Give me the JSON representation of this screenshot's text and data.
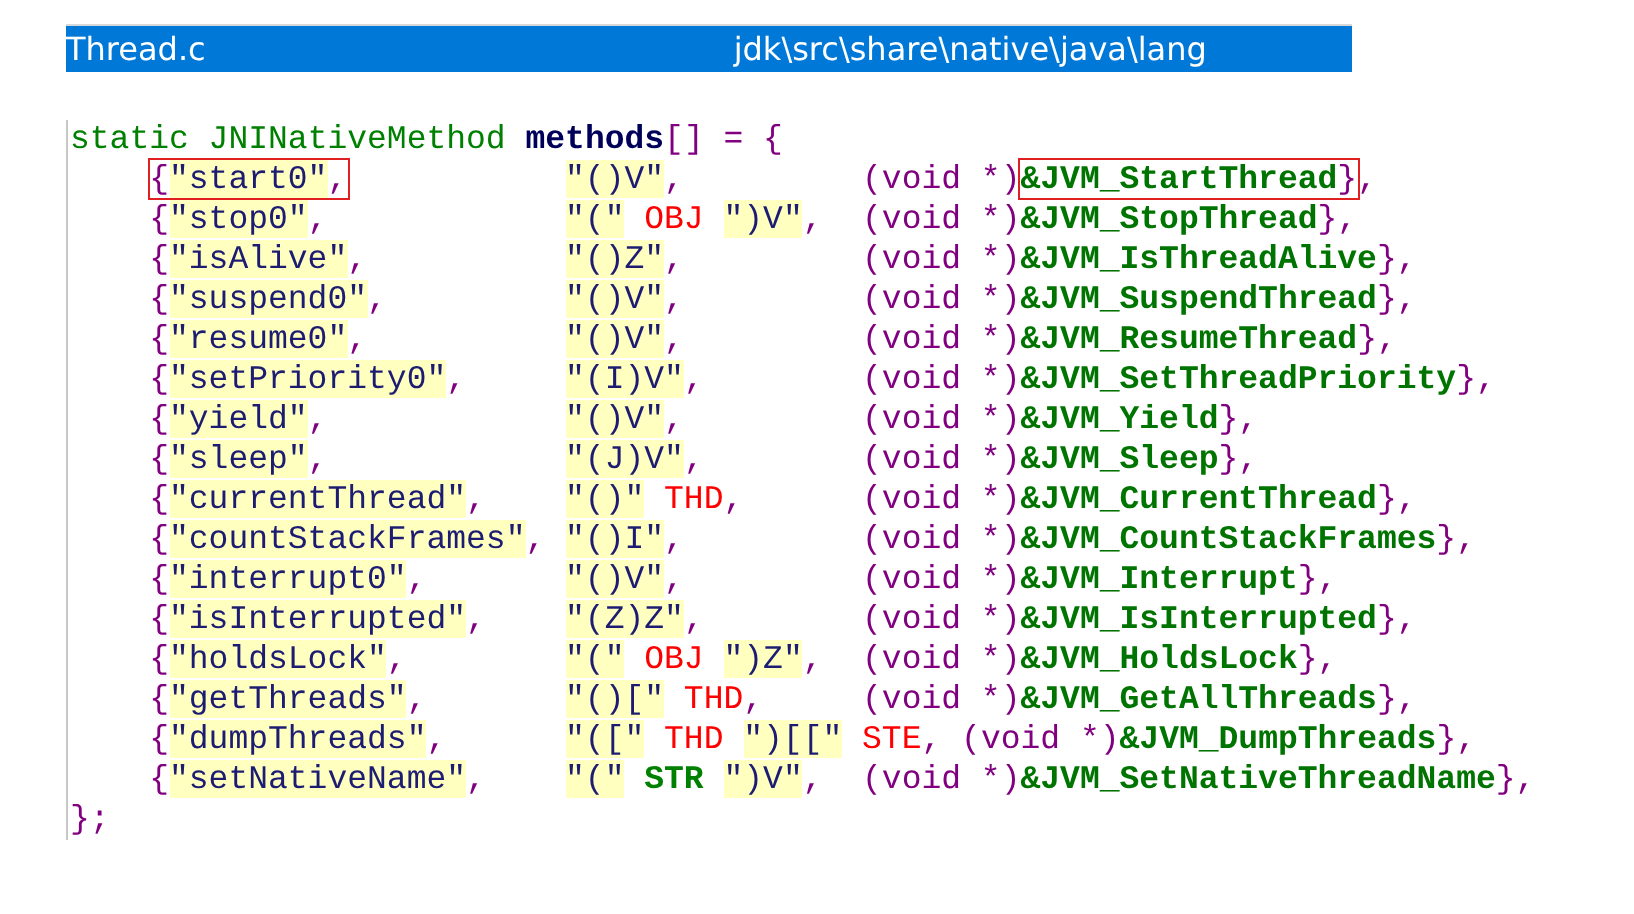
{
  "file_bar": {
    "file_name": "Thread.c",
    "path": "jdk\\src\\share\\native\\java\\lang"
  },
  "code": {
    "declaration": [
      {
        "kind": "keyword",
        "text": "static JNINativeMethod"
      },
      {
        "kind": "identifier",
        "text": "methods"
      },
      {
        "kind": "punct",
        "text": "[] = {"
      }
    ],
    "rows": [
      {
        "open": "{",
        "name": "\"start0\"",
        "sep": ",",
        "signature": [
          {
            "kind": "string",
            "text": "\"()V\""
          }
        ],
        "tail": ",",
        "cast": "(void *)",
        "target": "&JVM_StartThread",
        "close": "}",
        "end": ",",
        "boxed": true
      },
      {
        "open": "{",
        "name": "\"stop0\"",
        "sep": ",",
        "signature": [
          {
            "kind": "string",
            "text": "\"(\""
          },
          {
            "kind": "macro",
            "text": "OBJ"
          },
          {
            "kind": "string",
            "text": "\")V\""
          }
        ],
        "tail": ",",
        "cast": "(void *)",
        "target": "&JVM_StopThread",
        "close": "}",
        "end": ",",
        "boxed": false
      },
      {
        "open": "{",
        "name": "\"isAlive\"",
        "sep": ",",
        "signature": [
          {
            "kind": "string",
            "text": "\"()Z\""
          }
        ],
        "tail": ",",
        "cast": "(void *)",
        "target": "&JVM_IsThreadAlive",
        "close": "}",
        "end": ",",
        "boxed": false
      },
      {
        "open": "{",
        "name": "\"suspend0\"",
        "sep": ",",
        "signature": [
          {
            "kind": "string",
            "text": "\"()V\""
          }
        ],
        "tail": ",",
        "cast": "(void *)",
        "target": "&JVM_SuspendThread",
        "close": "}",
        "end": ",",
        "boxed": false
      },
      {
        "open": "{",
        "name": "\"resume0\"",
        "sep": ",",
        "signature": [
          {
            "kind": "string",
            "text": "\"()V\""
          }
        ],
        "tail": ",",
        "cast": "(void *)",
        "target": "&JVM_ResumeThread",
        "close": "}",
        "end": ",",
        "boxed": false
      },
      {
        "open": "{",
        "name": "\"setPriority0\"",
        "sep": ",",
        "signature": [
          {
            "kind": "string",
            "text": "\"(I)V\""
          }
        ],
        "tail": ",",
        "cast": "(void *)",
        "target": "&JVM_SetThreadPriority",
        "close": "}",
        "end": ",",
        "boxed": false
      },
      {
        "open": "{",
        "name": "\"yield\"",
        "sep": ",",
        "signature": [
          {
            "kind": "string",
            "text": "\"()V\""
          }
        ],
        "tail": ",",
        "cast": "(void *)",
        "target": "&JVM_Yield",
        "close": "}",
        "end": ",",
        "boxed": false
      },
      {
        "open": "{",
        "name": "\"sleep\"",
        "sep": ",",
        "signature": [
          {
            "kind": "string",
            "text": "\"(J)V\""
          }
        ],
        "tail": ",",
        "cast": "(void *)",
        "target": "&JVM_Sleep",
        "close": "}",
        "end": ",",
        "boxed": false
      },
      {
        "open": "{",
        "name": "\"currentThread\"",
        "sep": ",",
        "signature": [
          {
            "kind": "string",
            "text": "\"()\""
          },
          {
            "kind": "macro",
            "text": "THD"
          }
        ],
        "tail": ",",
        "cast": "(void *)",
        "target": "&JVM_CurrentThread",
        "close": "}",
        "end": ",",
        "boxed": false
      },
      {
        "open": "{",
        "name": "\"countStackFrames\"",
        "sep": ",",
        "signature": [
          {
            "kind": "string",
            "text": "\"()I\""
          }
        ],
        "tail": ",",
        "cast": "(void *)",
        "target": "&JVM_CountStackFrames",
        "close": "}",
        "end": ",",
        "boxed": false
      },
      {
        "open": "{",
        "name": "\"interrupt0\"",
        "sep": ",",
        "signature": [
          {
            "kind": "string",
            "text": "\"()V\""
          }
        ],
        "tail": ",",
        "cast": "(void *)",
        "target": "&JVM_Interrupt",
        "close": "}",
        "end": ",",
        "boxed": false
      },
      {
        "open": "{",
        "name": "\"isInterrupted\"",
        "sep": ",",
        "signature": [
          {
            "kind": "string",
            "text": "\"(Z)Z\""
          }
        ],
        "tail": ",",
        "cast": "(void *)",
        "target": "&JVM_IsInterrupted",
        "close": "}",
        "end": ",",
        "boxed": false
      },
      {
        "open": "{",
        "name": "\"holdsLock\"",
        "sep": ",",
        "signature": [
          {
            "kind": "string",
            "text": "\"(\""
          },
          {
            "kind": "macro",
            "text": "OBJ"
          },
          {
            "kind": "string",
            "text": "\")Z\""
          }
        ],
        "tail": ",",
        "cast": "(void *)",
        "target": "&JVM_HoldsLock",
        "close": "}",
        "end": ",",
        "boxed": false
      },
      {
        "open": "{",
        "name": "\"getThreads\"",
        "sep": ",",
        "signature": [
          {
            "kind": "string",
            "text": "\"()[\""
          },
          {
            "kind": "macro",
            "text": "THD"
          }
        ],
        "tail": ",",
        "cast": "(void *)",
        "target": "&JVM_GetAllThreads",
        "close": "}",
        "end": ",",
        "boxed": false
      },
      {
        "open": "{",
        "name": "\"dumpThreads\"",
        "sep": ",",
        "signature": [
          {
            "kind": "string",
            "text": "\"([\""
          },
          {
            "kind": "macro",
            "text": "THD"
          },
          {
            "kind": "string",
            "text": "\")[[\""
          },
          {
            "kind": "macro",
            "text": "STE"
          }
        ],
        "tail": ",",
        "cast": "(void *)",
        "target": "&JVM_DumpThreads",
        "close": "}",
        "end": ",",
        "boxed": false
      },
      {
        "open": "{",
        "name": "\"setNativeName\"",
        "sep": ",",
        "signature": [
          {
            "kind": "string",
            "text": "\"(\""
          },
          {
            "kind": "type_macro",
            "text": "STR"
          },
          {
            "kind": "string",
            "text": "\")V\""
          }
        ],
        "tail": ",",
        "cast": "(void *)",
        "target": "&JVM_SetNativeThreadName",
        "close": "}",
        "end": ",",
        "boxed": false
      }
    ],
    "closing": "};"
  }
}
